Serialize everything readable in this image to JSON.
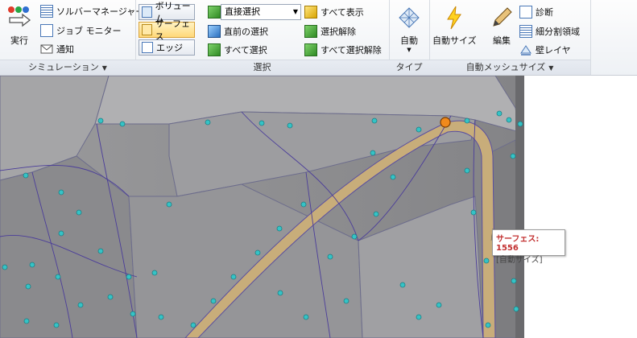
{
  "ribbon": {
    "simulation": {
      "run_label": "実行",
      "solver_manager": "ソルバーマネージャー",
      "job_monitor": "ジョブ モニター",
      "notify": "通知",
      "group_label": "シミュレーション"
    },
    "selection": {
      "volume": "ボリューム",
      "surface": "サーフェス",
      "edge": "エッジ",
      "mode_value": "直接選択",
      "previous": "直前の選択",
      "select_all": "すべて選択",
      "show_all": "すべて表示",
      "deselect": "選択解除",
      "deselect_all": "すべて選択解除",
      "group_label": "選択"
    },
    "type": {
      "auto": "自動",
      "group_label": "タイプ"
    },
    "automesh": {
      "auto_size": "自動サイズ",
      "edit": "編集",
      "diagnose": "診断",
      "subdivide": "細分割領域",
      "wall_layer": "壁レイヤ",
      "group_label": "自動メッシュサイズ"
    }
  },
  "tooltip": {
    "title": "サーフェス: 1556",
    "subtitle": "[自動サイズ]"
  },
  "colors": {
    "viewport_bg": "#8e8e90",
    "mesh_node": "#35c3c6",
    "highlight_surface": "#c8ad7a",
    "active_node": "#f08a1c"
  }
}
